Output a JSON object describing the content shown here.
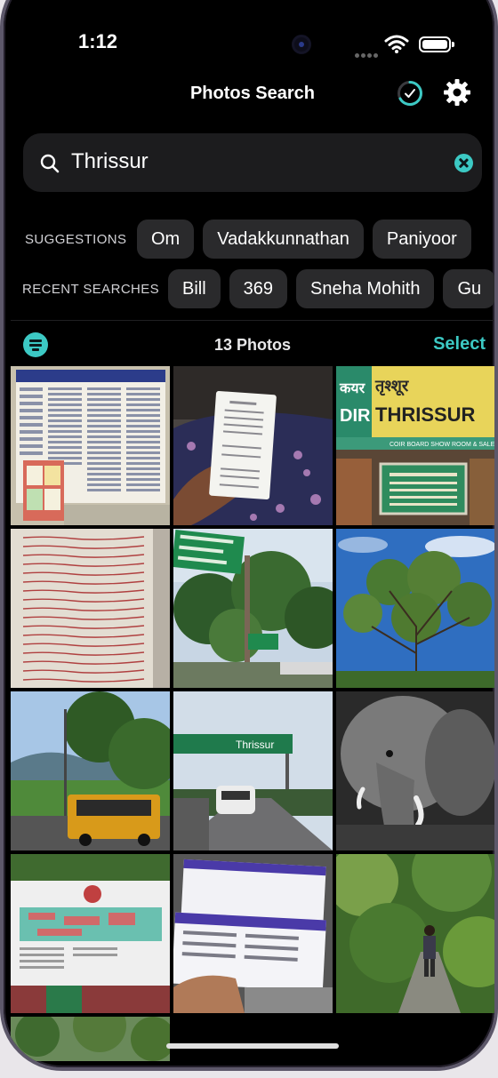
{
  "status": {
    "time": "1:12"
  },
  "header": {
    "title": "Photos Search"
  },
  "search": {
    "query": "Thrissur"
  },
  "suggestions": {
    "label": "SUGGESTIONS",
    "items": [
      "Om",
      "Vadakkunnathan",
      "Paniyoor"
    ]
  },
  "recent": {
    "label": "RECENT SEARCHES",
    "items": [
      "Bill",
      "369",
      "Sneha Mohith",
      "Gu"
    ]
  },
  "results": {
    "count_label": "13 Photos",
    "select_label": "Select"
  },
  "photos": [
    {
      "subject": "temple-notice-board"
    },
    {
      "subject": "receipt-in-hand"
    },
    {
      "subject": "thrissur-signboard"
    },
    {
      "subject": "handwritten-notes"
    },
    {
      "subject": "highway-sign-trees"
    },
    {
      "subject": "tree-blue-sky"
    },
    {
      "subject": "yellow-bus-road"
    },
    {
      "subject": "thrissur-highway-sign"
    },
    {
      "subject": "elephant-bw"
    },
    {
      "subject": "museum-map-board"
    },
    {
      "subject": "boarding-passes"
    },
    {
      "subject": "forest-path-person"
    },
    {
      "subject": "trees-partial"
    }
  ],
  "signage": {
    "thrissur": "THRISSUR",
    "highway": "Thrissur"
  },
  "colors": {
    "accent": "#3cc9c4",
    "background": "#000000",
    "chip": "#2a2a2c"
  }
}
